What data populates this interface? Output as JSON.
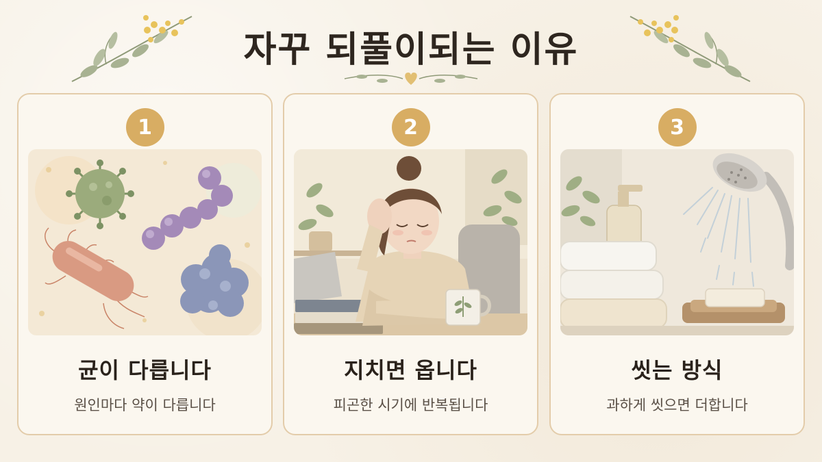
{
  "header": {
    "title": "자꾸 되풀이되는 이유"
  },
  "cards": [
    {
      "number": "1",
      "title": "균이 다릅니다",
      "subtitle": "원인마다 약이 다릅니다",
      "illustration": "germs-icon"
    },
    {
      "number": "2",
      "title": "지치면 옵니다",
      "subtitle": "피곤한 시기에 반복됩니다",
      "illustration": "tired-person-icon"
    },
    {
      "number": "3",
      "title": "씻는 방식",
      "subtitle": "과하게 씻으면 더합니다",
      "illustration": "shower-towel-icon"
    }
  ],
  "colors": {
    "badge": "#d8ad63",
    "card_border": "#e3ccaa",
    "background": "#f7f1e6"
  }
}
